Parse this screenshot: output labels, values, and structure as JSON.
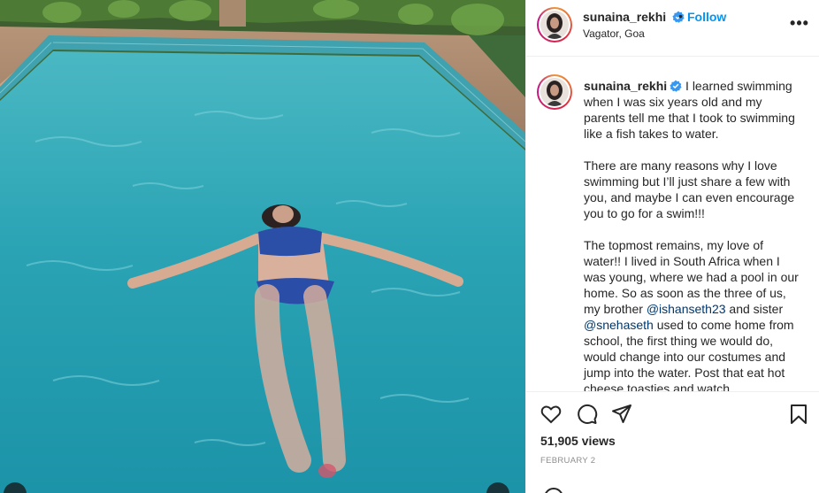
{
  "post": {
    "username": "sunaina_rekhi",
    "follow_label": "Follow",
    "separator": "•",
    "location": "Vagator, Goa",
    "more_label": "•••",
    "views": "51,905 views",
    "date": "FEBRUARY 2"
  },
  "caption": {
    "intro": " I learned swimming when I was six years old and my parents tell me that I took to swimming like a fish takes to water.",
    "p2": "There are many reasons why I love swimming but I’ll just share a few with you, and maybe I can even encourage you to go for a swim!!!",
    "p3_a": "The topmost remains, my love of water!! I lived in South Africa when I was young, where we had a pool in our home. So as soon as the three of us, my brother ",
    "mention1": "@ishanseth23",
    "p3_b": " and sister ",
    "mention2": "@snehaseth",
    "p3_c": " used to come home from school, the first thing we would do, would change into our costumes and jump into the water. Post that eat hot cheese toasties and watch"
  },
  "icons": {
    "verified": "verified-badge-icon",
    "like": "heart-icon",
    "comment": "comment-bubble-icon",
    "share": "paper-plane-icon",
    "save": "bookmark-icon"
  },
  "colors": {
    "link_blue": "#0095f6",
    "mention": "#00376b",
    "verified": "#3897f0",
    "muted": "#8e8e8e",
    "pool_water": "#2fa6b6"
  }
}
